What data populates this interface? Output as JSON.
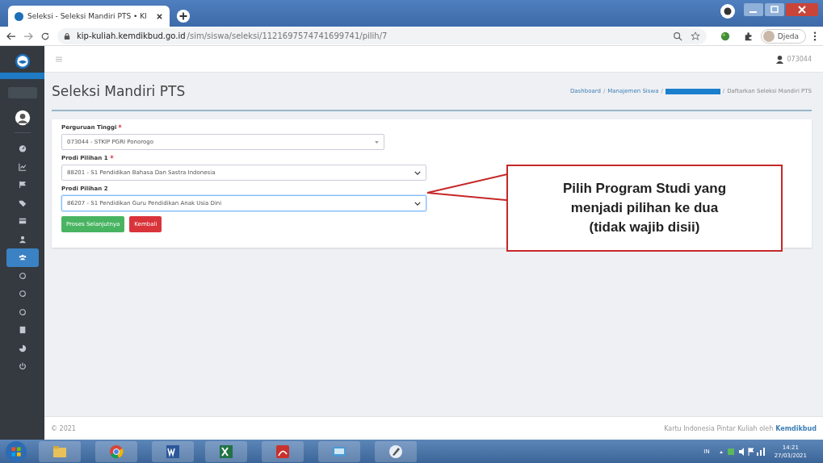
{
  "browser": {
    "tab_title": "Seleksi - Seleksi Mandiri PTS • KI",
    "url_domain": "kip-kuliah.kemdikbud.go.id",
    "url_path": "/sim/siswa/seleksi/1121697574741699741/pilih/7",
    "profile": "Djeda"
  },
  "topbar": {
    "user": "073044"
  },
  "sidebar": {
    "items": [
      {
        "kind": "gauge",
        "selected": false
      },
      {
        "kind": "chart",
        "selected": false
      },
      {
        "kind": "flag",
        "selected": false
      },
      {
        "kind": "tag",
        "selected": false
      },
      {
        "kind": "card",
        "selected": false
      },
      {
        "kind": "user",
        "selected": false
      },
      {
        "kind": "users",
        "selected": true
      },
      {
        "kind": "circle",
        "selected": false
      },
      {
        "kind": "circle",
        "selected": false
      },
      {
        "kind": "circle",
        "selected": false
      },
      {
        "kind": "book",
        "selected": false
      },
      {
        "kind": "pie",
        "selected": false
      },
      {
        "kind": "power",
        "selected": false
      }
    ]
  },
  "page": {
    "title": "Seleksi Mandiri PTS",
    "breadcrumb_separator": "/",
    "breadcrumbs": [
      {
        "kind": "text",
        "label": "Dashboard"
      },
      {
        "kind": "text",
        "label": "Manajemen Siswa"
      },
      {
        "kind": "redacted"
      },
      {
        "kind": "text",
        "label": "Daftarkan Seleksi Mandiri PTS"
      }
    ]
  },
  "form": {
    "fields": [
      {
        "label": "Perguruan Tinggi",
        "required": true,
        "kind": "search-select",
        "value": "073044 - STKIP PGRI Ponorogo",
        "focused": false
      },
      {
        "label": "Prodi Pilihan 1",
        "required": true,
        "kind": "select",
        "value": "88201 - S1 Pendidikan Bahasa Dan Sastra Indonesia",
        "focused": false
      },
      {
        "label": "Prodi Pilihan 2",
        "required": false,
        "kind": "select",
        "value": "86207 - S1 Pendidikan Guru Pendidikan Anak Usia Dini",
        "focused": true
      }
    ],
    "buttons": [
      {
        "label": "Proses Selanjutnya",
        "kind": "success"
      },
      {
        "label": "Kembali",
        "kind": "danger"
      }
    ]
  },
  "callout": {
    "lines": [
      "Pilih Program Studi yang",
      "menjadi pilihan ke dua",
      "(tidak wajib disii)"
    ]
  },
  "footer": {
    "copyright": "© 2021",
    "credit": "Kartu Indonesia Pintar Kuliah oleh",
    "link": "Kemdikbud"
  },
  "taskbar": {
    "apps": [
      {
        "kind": "folder"
      },
      {
        "kind": "chrome"
      },
      {
        "kind": "word"
      },
      {
        "kind": "excel"
      },
      {
        "kind": "pdf"
      },
      {
        "kind": "screen"
      },
      {
        "kind": "pen"
      }
    ],
    "language": "IN",
    "time": "14:21",
    "date": "27/03/2021"
  }
}
